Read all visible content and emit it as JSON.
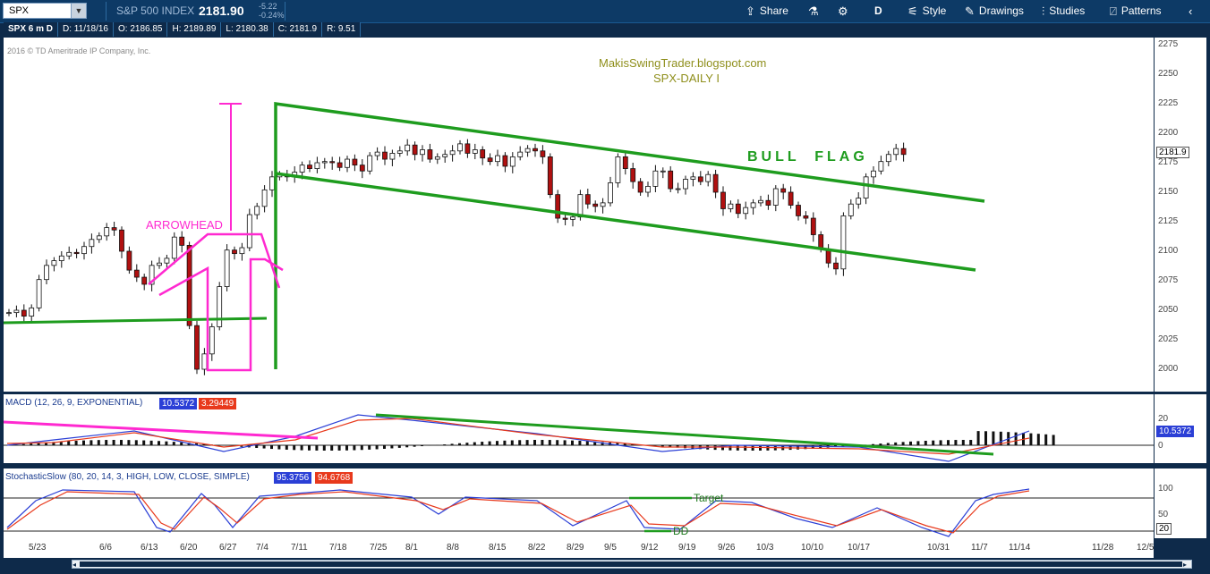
{
  "toolbar": {
    "symbol": "SPX",
    "index_name": "S&P 500 INDEX",
    "price": "2181.90",
    "change": "-5.22",
    "change_pct": "-0.24%",
    "share_label": "Share",
    "period_label": "D",
    "style_label": "Style",
    "drawings_label": "Drawings",
    "studies_label": "Studies",
    "patterns_label": "Patterns"
  },
  "info": {
    "symbol_period": "SPX 6 m D",
    "date": "D: 11/18/16",
    "open": "O: 2186.85",
    "high": "H: 2189.89",
    "low": "L: 2180.38",
    "close": "C: 2181.9",
    "range": "R: 9.51",
    "copyright": "2016 © TD Ameritrade IP Company, Inc."
  },
  "annotations": {
    "blog": "MakisSwingTrader.blogspot.com",
    "subtitle": "SPX-DAILY  I",
    "bull_flag": "BULL  FLAG",
    "arrowhead": "ARROWHEAD",
    "target": "Target",
    "dd": "DD"
  },
  "price_axis": {
    "ticks": [
      "2275",
      "2250",
      "2225",
      "2200",
      "2175",
      "2150",
      "2125",
      "2100",
      "2075",
      "2050",
      "2025",
      "2000"
    ],
    "current_label": "2181.9"
  },
  "macd": {
    "title": "MACD (12, 26, 9, EXPONENTIAL)",
    "value": "10.5372",
    "signal": "3.29449",
    "axis_ticks": [
      "20",
      "0"
    ],
    "current_label": "10.5372"
  },
  "stoch": {
    "title": "StochasticSlow (80, 20, 14, 3, HIGH, LOW, CLOSE, SIMPLE)",
    "k": "95.3756",
    "d": "94.6768",
    "axis_ticks": [
      "100",
      "50"
    ],
    "current_label": "20"
  },
  "x_axis": [
    "5/23",
    "6/6",
    "6/13",
    "6/20",
    "6/27",
    "7/4",
    "7/11",
    "7/18",
    "7/25",
    "8/1",
    "8/8",
    "8/15",
    "8/22",
    "8/29",
    "9/5",
    "9/12",
    "9/19",
    "9/26",
    "10/3",
    "10/10",
    "10/17",
    "10/31",
    "11/7",
    "11/14",
    "11/28",
    "12/5"
  ],
  "colors": {
    "up_candle": "#ffffff",
    "down_candle": "#b01010",
    "annotation_green": "#1e9c1e",
    "annotation_magenta": "#ff29d0",
    "macd_line": "#2b3fd6",
    "signal_line": "#e8391c",
    "header_bg": "#0d3a66"
  }
}
